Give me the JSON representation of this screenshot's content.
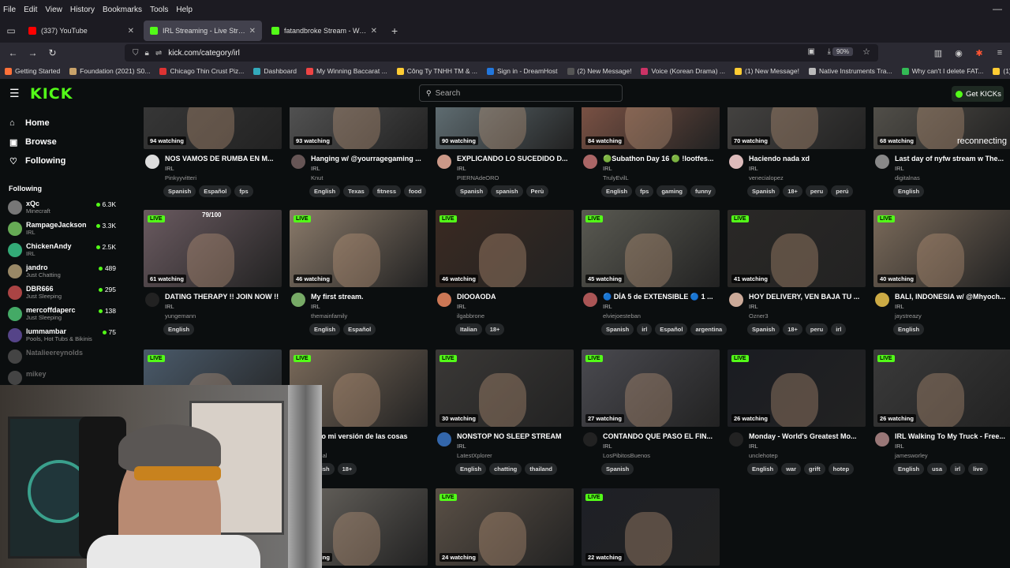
{
  "menubar": {
    "items": [
      "File",
      "Edit",
      "View",
      "History",
      "Bookmarks",
      "Tools",
      "Help"
    ],
    "min_glyph": "—"
  },
  "tabs": [
    {
      "label": "(337) YouTube",
      "color": "#ff0000",
      "active": false
    },
    {
      "label": "IRL Streaming - Live Streams on Kick",
      "color": "#53fc18",
      "active": true
    },
    {
      "label": "fatandbroke Stream - Watch Live on Kick",
      "color": "#53fc18",
      "active": false
    }
  ],
  "url": {
    "text": "kick.com/category/irl",
    "zoom": "90%"
  },
  "bookmarks": [
    {
      "label": "Getting Started",
      "color": "#ff7139"
    },
    {
      "label": "Foundation (2021) S0...",
      "color": "#c9a36a"
    },
    {
      "label": "Chicago Thin Crust Piz...",
      "color": "#d33"
    },
    {
      "label": "Dashboard",
      "color": "#3ab"
    },
    {
      "label": "My Winning Baccarat ...",
      "color": "#e44"
    },
    {
      "label": "Công Ty TNHH TM & ...",
      "color": "#ffcc33"
    },
    {
      "label": "Sign in - DreamHost",
      "color": "#2277dd"
    },
    {
      "label": "(2) New Message!",
      "color": "#555"
    },
    {
      "label": "Voice (Korean Drama) ...",
      "color": "#cc3366"
    },
    {
      "label": "(1) New Message!",
      "color": "#ffcc33"
    },
    {
      "label": "Native Instruments Tra...",
      "color": "#bbb"
    },
    {
      "label": "Why can't I delete FAT...",
      "color": "#3b5"
    },
    {
      "label": "(1) New Message!",
      "color": "#ffcc33"
    }
  ],
  "header": {
    "logo": "KICK",
    "search_placeholder": "Search",
    "get_kicks": "Get KICKs"
  },
  "sidebar": {
    "nav": [
      {
        "label": "Home",
        "icon": "⌂"
      },
      {
        "label": "Browse",
        "icon": "▣"
      },
      {
        "label": "Following",
        "icon": "♡"
      }
    ],
    "following_title": "Following",
    "following": [
      {
        "name": "xQc",
        "category": "Minecraft",
        "count": "6.3K",
        "color": "#777"
      },
      {
        "name": "RampageJackson",
        "category": "IRL",
        "count": "3.3K",
        "color": "#6a5"
      },
      {
        "name": "ChickenAndy",
        "category": "IRL",
        "count": "2.5K",
        "color": "#3a7"
      },
      {
        "name": "jandro",
        "category": "Just Chatting",
        "count": "489",
        "color": "#986"
      },
      {
        "name": "DBR666",
        "category": "Just Sleeping",
        "count": "295",
        "color": "#a44"
      },
      {
        "name": "mercoffdaperc",
        "category": "Just Sleeping",
        "count": "138",
        "color": "#4a6"
      },
      {
        "name": "lummambar",
        "category": "Pools, Hot Tubs & Bikinis",
        "count": "75",
        "color": "#548"
      },
      {
        "name": "Natalieereynolds",
        "category": "",
        "count": "",
        "color": "#444"
      },
      {
        "name": "mikey",
        "category": "",
        "count": "",
        "color": "#444"
      }
    ]
  },
  "streams": [
    {
      "title": "NOS VAMOS DE RUMBA EN M...",
      "category": "IRL",
      "user": "Pinkyyvitteri",
      "watching": "94 watching",
      "live": false,
      "tags": [
        "Spanish",
        "Español",
        "fps"
      ],
      "thumb": "#3a3a3a",
      "avatar": "#ddd"
    },
    {
      "title": "Hanging w/ @yourragegaming ...",
      "category": "IRL",
      "user": "Knut",
      "watching": "93 watching",
      "live": false,
      "tags": [
        "English",
        "Texas",
        "fitness",
        "food"
      ],
      "thumb": "#5a5a5a",
      "avatar": "#655"
    },
    {
      "title": "EXPLICANDO LO SUCEDIDO D...",
      "category": "IRL",
      "user": "PIERNAdeORO",
      "watching": "90 watching",
      "live": false,
      "tags": [
        "Spanish",
        "spanish",
        "Perù"
      ],
      "thumb": "#6a7a80",
      "avatar": "#c98"
    },
    {
      "title": "🟢Subathon Day 16 🟢 !lootfes...",
      "category": "IRL",
      "user": "TrulyEvilL",
      "watching": "84 watching",
      "live": false,
      "tags": [
        "English",
        "fps",
        "gaming",
        "funny"
      ],
      "thumb": "#8a5a4a",
      "avatar": "#a66"
    },
    {
      "title": "Haciendo nada xd",
      "category": "IRL",
      "user": "venecialopez",
      "watching": "70 watching",
      "live": false,
      "tags": [
        "Spanish",
        "18+",
        "peru",
        "perú"
      ],
      "thumb": "#4a4846",
      "avatar": "#dbb"
    },
    {
      "title": "Last day of nyfw stream w The...",
      "category": "IRL",
      "user": "digitalnas",
      "watching": "68 watching",
      "live": false,
      "tags": [
        "English"
      ],
      "thumb": "#5a5750",
      "avatar": "#888"
    },
    {
      "title": "DATING THERAPY !! JOIN NOW !!",
      "category": "IRL",
      "user": "yungemann",
      "watching": "61 watching",
      "live": true,
      "tags": [
        "English"
      ],
      "thumb": "#6a5a60",
      "avatar": "#222"
    },
    {
      "title": "My first stream.",
      "category": "IRL",
      "user": "themainfamily",
      "watching": "46 watching",
      "live": true,
      "tags": [
        "English",
        "Español"
      ],
      "thumb": "#8a7a6a",
      "avatar": "#7a6"
    },
    {
      "title": "DIOOAODA",
      "category": "IRL",
      "user": "ilgabbrone",
      "watching": "46 watching",
      "live": true,
      "tags": [
        "Italian",
        "18+"
      ],
      "thumb": "#3a2a22",
      "avatar": "#c75"
    },
    {
      "title": "🔵 DÍA 5 de EXTENSIBLE 🔵 1 ...",
      "category": "IRL",
      "user": "elviejoesteban",
      "watching": "45 watching",
      "live": true,
      "tags": [
        "Spanish",
        "irl",
        "Español",
        "argentina"
      ],
      "thumb": "#5a5a52",
      "avatar": "#a55"
    },
    {
      "title": "HOY DELIVERY, VEN BAJA TU ...",
      "category": "IRL",
      "user": "Ozner3",
      "watching": "41 watching",
      "live": true,
      "tags": [
        "Spanish",
        "18+",
        "peru",
        "irl"
      ],
      "thumb": "#2a2826",
      "avatar": "#ca9"
    },
    {
      "title": "BALI, INDONESIA w/ @Mhyoch...",
      "category": "IRL",
      "user": "jaystreazy",
      "watching": "40 watching",
      "live": true,
      "tags": [
        "English"
      ],
      "thumb": "#7a6a5a",
      "avatar": "#ca4"
    },
    {
      "title": "",
      "category": "",
      "user": "",
      "watching": "",
      "live": true,
      "tags": [],
      "thumb": "#4a5a6a",
      "avatar": "#444"
    },
    {
      "title": "ento mi versión de las cosas",
      "category": "",
      "user": "tbanal",
      "watching": "",
      "live": true,
      "tags": [
        "anish",
        "18+"
      ],
      "thumb": "#7a6a5a",
      "avatar": "#444"
    },
    {
      "title": "NONSTOP NO SLEEP STREAM",
      "category": "IRL",
      "user": "LatestXplorer",
      "watching": "30 watching",
      "live": true,
      "tags": [
        "English",
        "chatting",
        "thailand"
      ],
      "thumb": "#3a3836",
      "avatar": "#36a"
    },
    {
      "title": "CONTANDO QUE PASO EL FIN...",
      "category": "IRL",
      "user": "LosPibitosBuenos",
      "watching": "27 watching",
      "live": true,
      "tags": [
        "Spanish"
      ],
      "thumb": "#4a4a50",
      "avatar": "#222"
    },
    {
      "title": "Monday - World's Greatest Mo...",
      "category": "IRL",
      "user": "unclehotep",
      "watching": "26 watching",
      "live": true,
      "tags": [
        "English",
        "war",
        "grift",
        "hotep"
      ],
      "thumb": "#1a1c22",
      "avatar": "#222"
    },
    {
      "title": "IRL Walking To My Truck - Free...",
      "category": "IRL",
      "user": "jamesworley",
      "watching": "26 watching",
      "live": true,
      "tags": [
        "English",
        "usa",
        "irl",
        "live"
      ],
      "thumb": "#3a3a3a",
      "avatar": "#977"
    },
    {
      "title": "",
      "category": "",
      "user": "",
      "watching": "",
      "live": false,
      "tags": [],
      "thumb": "#666",
      "avatar": "#444"
    },
    {
      "title": "",
      "category": "",
      "user": "",
      "watching": "25 watching",
      "live": true,
      "tags": [],
      "thumb": "#6a6660",
      "avatar": "#444"
    },
    {
      "title": "",
      "category": "",
      "user": "",
      "watching": "24 watching",
      "live": true,
      "tags": [],
      "thumb": "#5a5046",
      "avatar": "#444"
    },
    {
      "title": "",
      "category": "",
      "user": "",
      "watching": "22 watching",
      "live": true,
      "tags": [],
      "thumb": "#1e2026",
      "avatar": "#444"
    }
  ],
  "overlays": {
    "counter": "79/100",
    "reconnecting": "reconnecting"
  },
  "colors": {
    "brand": "#53fc18"
  }
}
